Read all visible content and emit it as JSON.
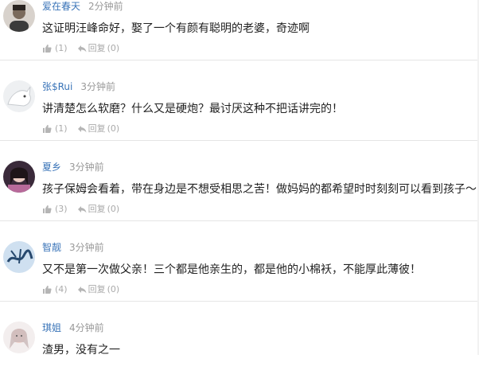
{
  "comments": [
    {
      "username": "爱在春天",
      "time": "2分钟前",
      "text": "这证明汪峰命好，娶了一个有颜有聪明的老婆，奇迹啊",
      "likes": "(1)",
      "reply_label": "回复",
      "reply_count": "(0)",
      "avatar_icon": "avatar-boy-icon"
    },
    {
      "username": "张$Rui",
      "time": "3分钟前",
      "text": "讲清楚怎么软磨？什么又是硬炮？最讨厌这种不把话讲完的！",
      "likes": "(1)",
      "reply_label": "回复",
      "reply_count": "(0)",
      "avatar_icon": "avatar-white-fox-icon"
    },
    {
      "username": "夏乡",
      "time": "3分钟前",
      "text": "孩子保姆会看着，带在身边是不想受相思之苦！做妈妈的都希望时时刻刻可以看到孩子～",
      "likes": "(3)",
      "reply_label": "回复",
      "reply_count": "(0)",
      "avatar_icon": "avatar-girl-icon"
    },
    {
      "username": "智靓",
      "time": "3分钟前",
      "text": "又不是第一次做父亲！三个都是他亲生的，都是他的小棉袄，不能厚此薄彼！",
      "likes": "(4)",
      "reply_label": "回复",
      "reply_count": "(0)",
      "avatar_icon": "avatar-blue-calligraphy-icon"
    },
    {
      "username": "琪姐",
      "time": "4分钟前",
      "text": "渣男，没有之一",
      "likes": "",
      "reply_label": "",
      "reply_count": "",
      "avatar_icon": "avatar-woman-icon"
    }
  ],
  "colors": {
    "username": "#3a74b8",
    "meta": "#999999",
    "action": "#aaaaaa",
    "divider": "#e5e5e5"
  }
}
